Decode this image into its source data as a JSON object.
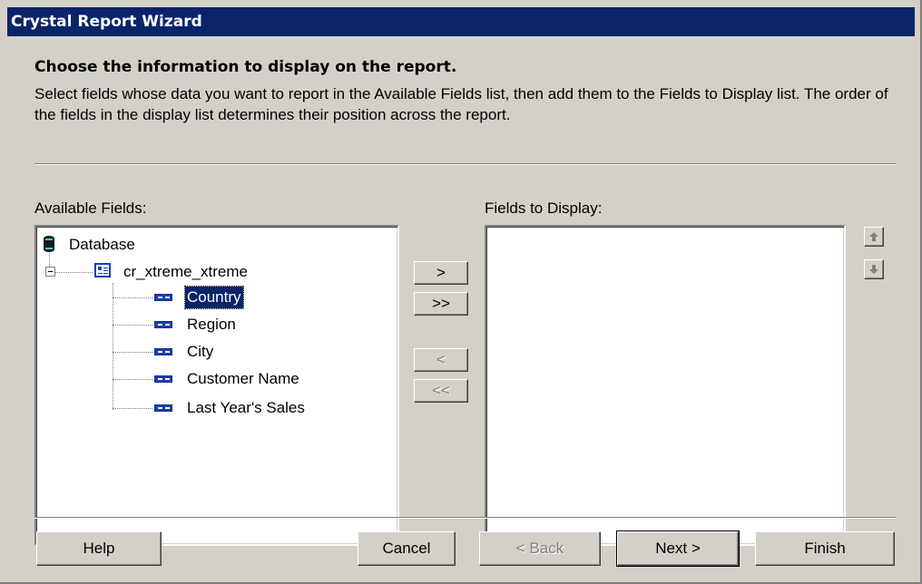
{
  "window": {
    "title": "Crystal Report Wizard"
  },
  "intro": {
    "heading": "Choose the information to display on the report.",
    "description": "Select fields whose data you want to report in the Available Fields list, then add them to the Fields to Display list. The order of the fields in the display list determines their position across the report."
  },
  "available_fields": {
    "label": "Available Fields:",
    "root": "Database",
    "table": "cr_xtreme_xtreme",
    "fields": [
      "Country",
      "Region",
      "City",
      "Customer Name",
      "Last Year's Sales"
    ],
    "selected_field": "Country"
  },
  "fields_to_display": {
    "label": "Fields to Display:",
    "items": []
  },
  "transfer_buttons": {
    "add": ">",
    "add_all": ">>",
    "remove": "<",
    "remove_all": "<<"
  },
  "order_buttons": {
    "up_icon": "arrow-up-icon",
    "down_icon": "arrow-down-icon"
  },
  "footer": {
    "help": "Help",
    "cancel": "Cancel",
    "back": "< Back",
    "next": "Next >",
    "finish": "Finish"
  },
  "colors": {
    "title_bar": "#0a246a",
    "dialog_bg": "#d4d0c8",
    "selection": "#0a246a"
  }
}
